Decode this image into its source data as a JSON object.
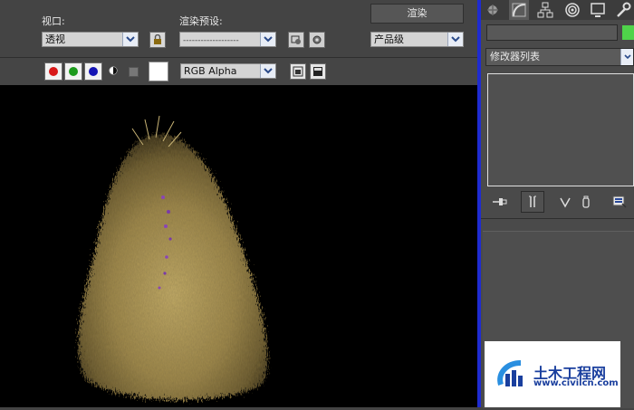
{
  "toolbar": {
    "viewport_label": "视口:",
    "viewport_value": "透视",
    "preset_label": "渲染预设:",
    "preset_value": "-------------------",
    "render_button": "渲染",
    "quality_value": "产品级"
  },
  "channels": {
    "red_color": "#d81818",
    "green_color": "#1c9a1c",
    "blue_color": "#1414b4",
    "display_value": "RGB Alpha"
  },
  "command_panel": {
    "modifier_list": "修改器列表",
    "object_color": "#4fd34a",
    "selection_color": "#1e2bd1"
  },
  "watermark": {
    "title": "土木工程网",
    "url": "www.civilcn.com"
  },
  "render": {
    "subject": "fur-covered cone render",
    "fur_color": "#b29a55",
    "background": "#000000"
  }
}
